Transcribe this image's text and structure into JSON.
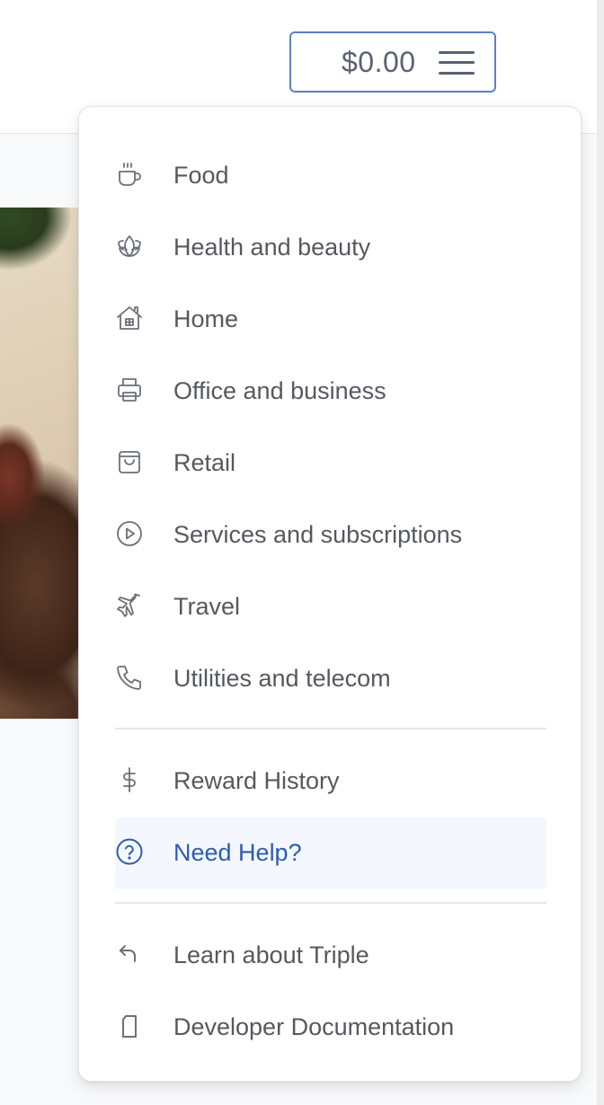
{
  "header": {
    "cart_amount": "$0.00",
    "menu_icon": "hamburger-icon"
  },
  "menu": {
    "categories": [
      {
        "label": "Food",
        "icon": "coffee-cup-icon"
      },
      {
        "label": "Health and beauty",
        "icon": "lotus-icon"
      },
      {
        "label": "Home",
        "icon": "house-icon"
      },
      {
        "label": "Office and business",
        "icon": "printer-icon"
      },
      {
        "label": "Retail",
        "icon": "shopping-bag-icon"
      },
      {
        "label": "Services and subscriptions",
        "icon": "play-circle-icon"
      },
      {
        "label": "Travel",
        "icon": "airplane-icon"
      },
      {
        "label": "Utilities and telecom",
        "icon": "phone-icon"
      }
    ],
    "account": [
      {
        "label": "Reward History",
        "icon": "dollar-icon"
      },
      {
        "label": "Need Help?",
        "icon": "question-circle-icon",
        "active": true
      }
    ],
    "links": [
      {
        "label": "Learn about Triple",
        "icon": "return-arrow-icon"
      },
      {
        "label": "Developer Documentation",
        "icon": "document-icon"
      }
    ]
  },
  "colors": {
    "accent": "#2f5bb0",
    "accent_border": "#5b7fc7",
    "text": "#55595f",
    "icon": "#6b7078",
    "active_bg": "#f4f8fe"
  }
}
